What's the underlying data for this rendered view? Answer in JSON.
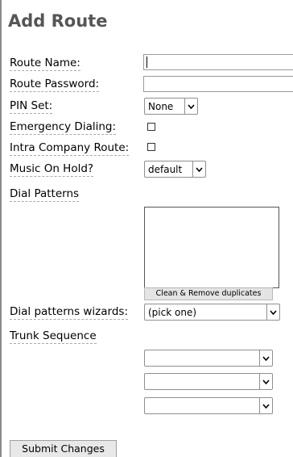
{
  "page": {
    "title": "Add Route"
  },
  "form": {
    "route_name": {
      "label": "Route Name:",
      "value": ""
    },
    "route_password": {
      "label": "Route Password:",
      "value": ""
    },
    "pin_set": {
      "label": "PIN Set:",
      "selected": "None"
    },
    "emergency_dialing": {
      "label": "Emergency Dialing:",
      "checked": false
    },
    "intra_company_route": {
      "label": "Intra Company Route:",
      "checked": false
    },
    "music_on_hold": {
      "label": "Music On Hold?",
      "selected": "default"
    },
    "dial_patterns": {
      "label": "Dial Patterns",
      "value": "",
      "clean_button_label": "Clean & Remove duplicates"
    },
    "dial_patterns_wizards": {
      "label": "Dial patterns wizards:",
      "selected": "(pick one)"
    },
    "trunk_sequence": {
      "label": "Trunk Sequence",
      "selects": [
        {
          "selected": ""
        },
        {
          "selected": ""
        },
        {
          "selected": ""
        }
      ]
    },
    "submit_label": "Submit Changes"
  },
  "icons": {
    "select_arrow": "chevron-down-icon"
  }
}
